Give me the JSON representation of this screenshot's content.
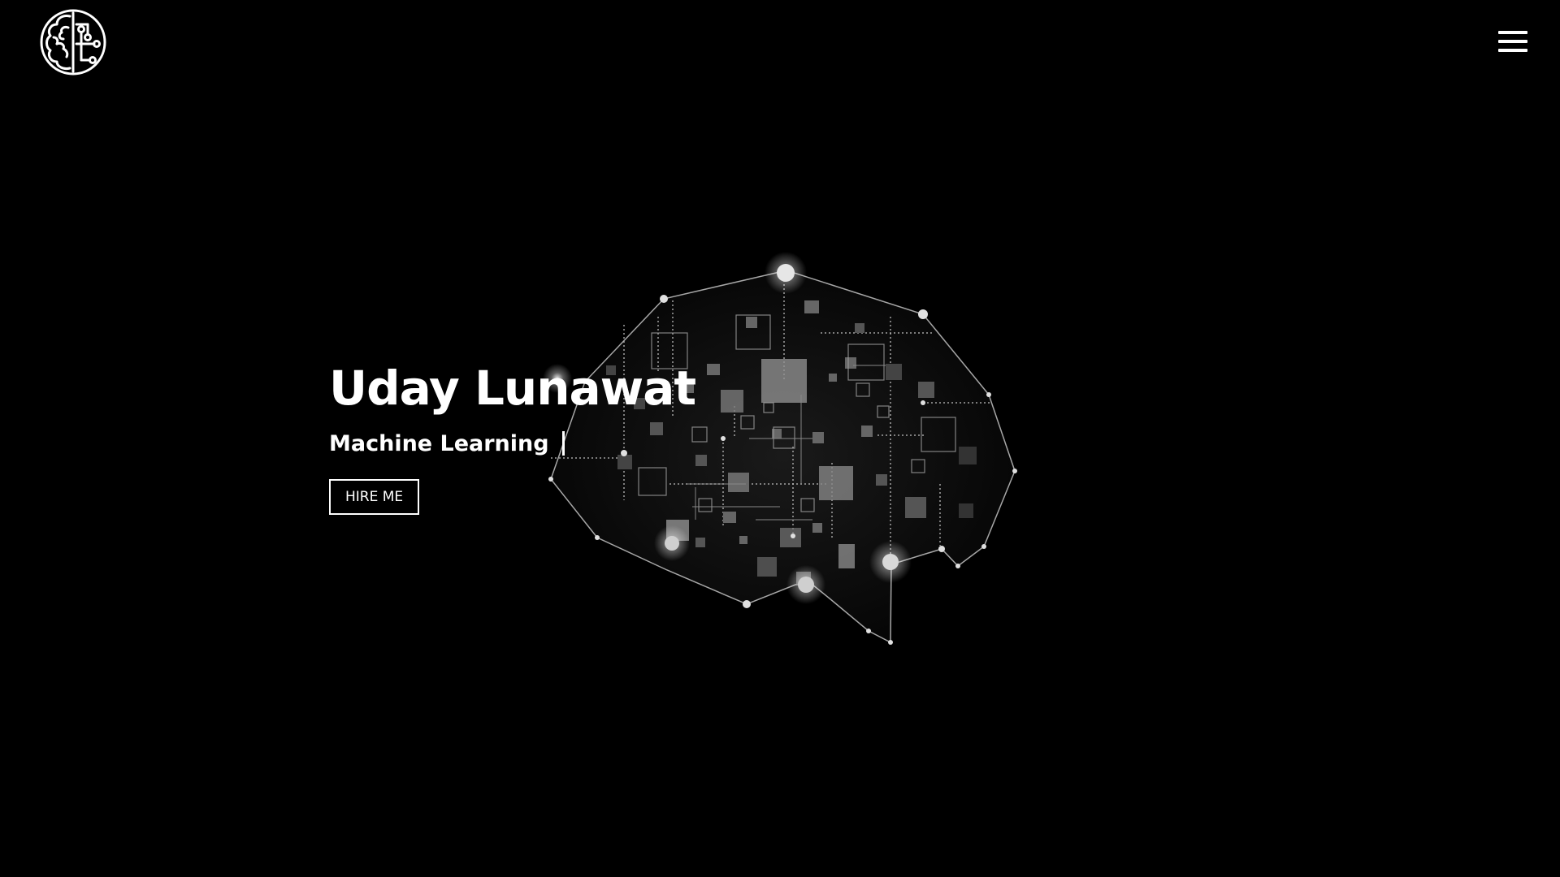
{
  "header": {
    "logo_icon": "brain-circuit-icon",
    "menu_icon": "hamburger-menu-icon"
  },
  "hero": {
    "name": "Uday Lunawat",
    "role": "Machine Learning",
    "cta_label": "HIRE ME"
  },
  "background": {
    "illustration": "brain-network-icon"
  },
  "colors": {
    "background": "#000000",
    "foreground": "#ffffff"
  }
}
